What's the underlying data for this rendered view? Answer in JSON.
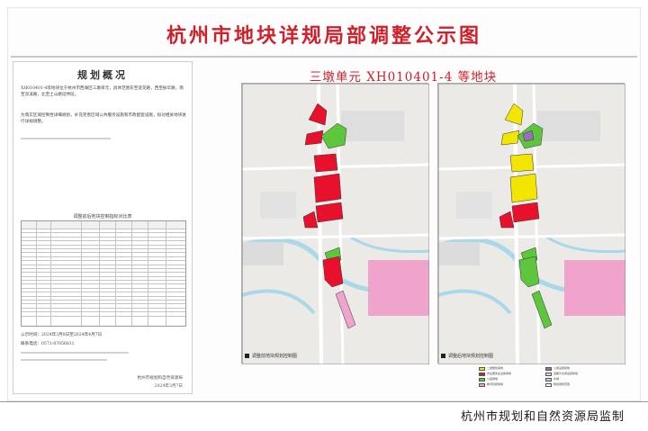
{
  "header": {
    "title": "杭州市地块详规局部调整公示图"
  },
  "overview": {
    "heading": "规划概况",
    "paragraph_1": "XH010401-4等地块位于杭州市西湖区三墩单元，具体范围东至莲花路，西至振华路，南至双溪路，北至土山路延伸段。",
    "paragraph_2": "为落实区域控制性详细规划，补充完善区域公共服务设施和市政配套设施，拟对相关地块进行详规调整。",
    "table_title": "调整前后地块控制指标对比表",
    "contact_1": "公示时间：2024年3月8日至2024年4月7日",
    "contact_2": "联系电话：0571-87056811",
    "date": "2024年3月7日",
    "sign": "杭州市规划和自然资源局"
  },
  "map": {
    "title": "三墩单元 XH010401-4 等地块",
    "caption_left": "调整前地块规划控制图",
    "caption_right": "调整后地块规划控制图"
  },
  "legend": [
    {
      "label": "二类居住用地",
      "color": "#f2e600"
    },
    {
      "label": "商业服务业设施用地",
      "color": "#e8112d"
    },
    {
      "label": "公园绿地",
      "color": "#5ec63c"
    },
    {
      "label": "教育科研用地",
      "color": "#f0a4cc"
    },
    {
      "label": "公用设施用地",
      "color": "#9b6fc0"
    },
    {
      "label": "道路与交通设施用地",
      "color": "#d9d9d9"
    },
    {
      "label": "水域",
      "color": "#a8d8ea"
    },
    {
      "label": "规划调整范围",
      "color": "#ffffff"
    }
  ],
  "footer": {
    "text": "杭州市规划和自然资源局监制"
  }
}
